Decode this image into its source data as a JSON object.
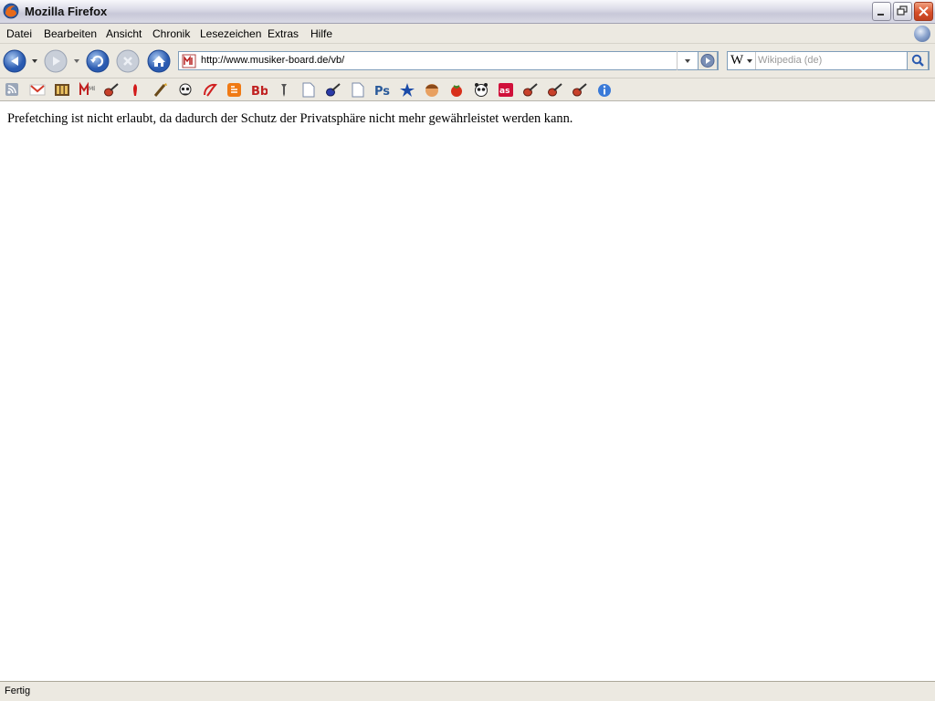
{
  "window": {
    "title": "Mozilla Firefox"
  },
  "menu": {
    "items": [
      "Datei",
      "Bearbeiten",
      "Ansicht",
      "Chronik",
      "Lesezeichen",
      "Extras",
      "Hilfe"
    ]
  },
  "navigation": {
    "url": "http://www.musiker-board.de/vb/",
    "search_engine_glyph": "W",
    "search_placeholder": "Wikipedia (de)",
    "icons": [
      "back-icon",
      "forward-icon",
      "reload-icon",
      "stop-icon",
      "home-icon",
      "go-icon",
      "search-icon"
    ]
  },
  "bookmarks": {
    "icons": [
      "rss-icon",
      "gmail-icon",
      "film-strip-icon",
      "mb-logo-icon",
      "guitar-icon",
      "red-figure-icon",
      "brush-icon",
      "skull-icon",
      "swirl-icon",
      "blogger-icon",
      "bb-icon",
      "pin-icon",
      "page-icon",
      "guitar-blue-icon",
      "page-icon",
      "photoshop-icon",
      "star-icon",
      "face-icon",
      "tomato-icon",
      "panda-icon",
      "lastfm-icon",
      "guitar-icon",
      "guitar-icon",
      "guitar-icon",
      "info-icon"
    ]
  },
  "content": {
    "message": "Prefetching ist nicht erlaubt, da dadurch der Schutz der Privatsphäre nicht mehr gewährleistet werden kann."
  },
  "status": {
    "text": "Fertig"
  },
  "colors": {
    "chrome": "#ece9e1",
    "field_border": "#7f9db9",
    "close_button": "#d8502a",
    "nav_blue": "#3a6fc4"
  }
}
